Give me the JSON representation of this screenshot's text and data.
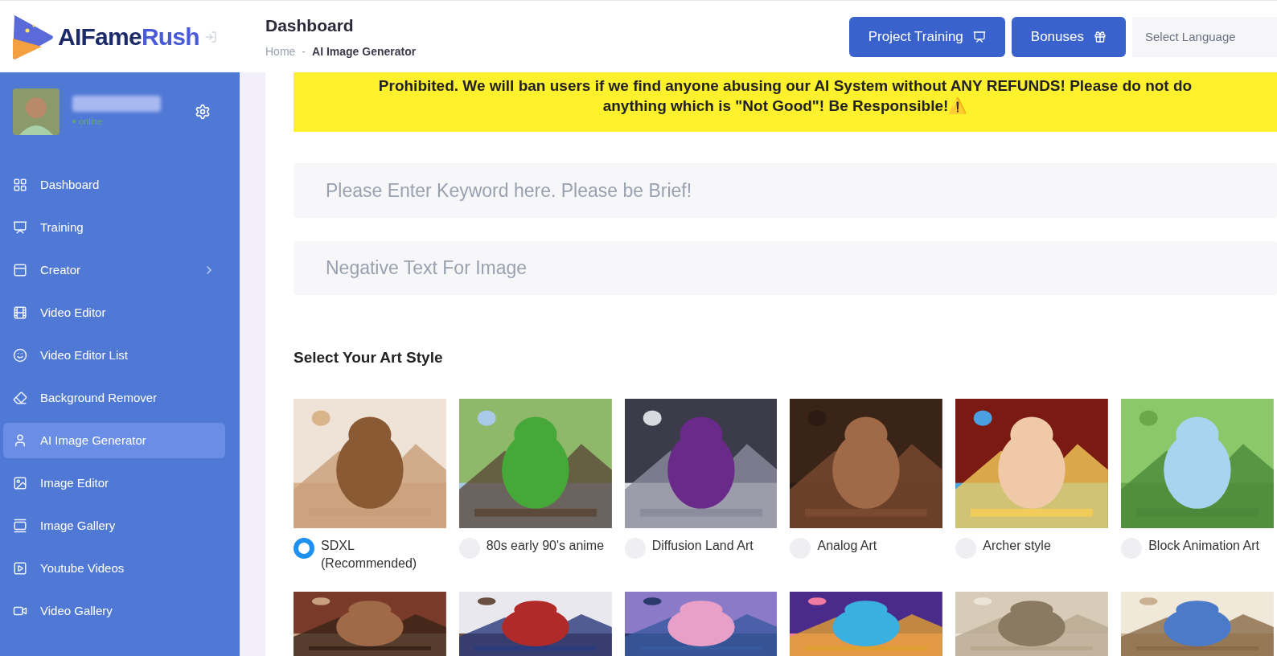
{
  "logo": {
    "text_dark": "AIFame",
    "text_light": "Rush"
  },
  "header": {
    "title": "Dashboard",
    "breadcrumb": [
      "Home",
      "AI Image Generator"
    ],
    "breadcrumb_separator": "-",
    "buttons": [
      {
        "label": "Project Training"
      },
      {
        "label": "Bonuses"
      }
    ],
    "language_select": {
      "placeholder": "Select Language"
    }
  },
  "user": {
    "status": "online"
  },
  "sidebar": {
    "items": [
      {
        "label": "Dashboard",
        "selected": false,
        "expandable": false
      },
      {
        "label": "Training",
        "selected": false,
        "expandable": false
      },
      {
        "label": "Creator",
        "selected": false,
        "expandable": true
      },
      {
        "label": "Video Editor",
        "selected": false,
        "expandable": false
      },
      {
        "label": "Video Editor List",
        "selected": false,
        "expandable": false
      },
      {
        "label": "Background Remover",
        "selected": false,
        "expandable": false
      },
      {
        "label": "AI Image Generator",
        "selected": true,
        "expandable": false
      },
      {
        "label": "Image Editor",
        "selected": false,
        "expandable": false
      },
      {
        "label": "Image Gallery",
        "selected": false,
        "expandable": false
      },
      {
        "label": "Youtube Videos",
        "selected": false,
        "expandable": false
      },
      {
        "label": "Video Gallery",
        "selected": false,
        "expandable": false
      }
    ]
  },
  "notice": {
    "lines": [
      "Prohibited. We will ban users if we find anyone abusing our AI System without ANY REFUNDS! Please do not do",
      "anything which is \"Not Good\"! Be Responsible!⚠️"
    ]
  },
  "keyword_field": {
    "placeholder": "Please Enter Keyword here. Please be Brief!"
  },
  "negative_field": {
    "placeholder": "Negative Text For Image"
  },
  "art_style": {
    "heading": "Select Your Art Style",
    "styles": [
      {
        "label": "SDXL (Recommended)",
        "selected": true
      },
      {
        "label": "80s early 90's anime",
        "selected": false
      },
      {
        "label": "Diffusion Land Art",
        "selected": false
      },
      {
        "label": "Analog Art",
        "selected": false
      },
      {
        "label": "Archer style",
        "selected": false
      },
      {
        "label": "Block Animation Art",
        "selected": false
      }
    ]
  }
}
